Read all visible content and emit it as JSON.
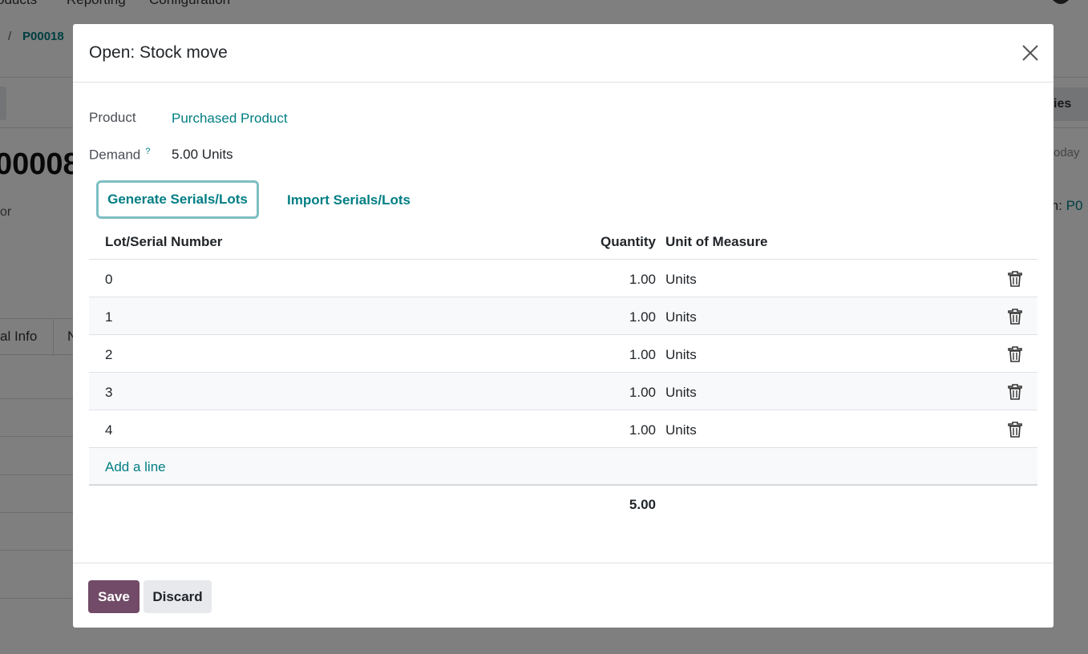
{
  "background": {
    "menu": [
      "oducts",
      "Reporting",
      "Configuration"
    ],
    "breadcrumb_separator": "/",
    "breadcrumb_current": "P00018",
    "record_title": "00008",
    "vendor_label_fragment": "or",
    "tab_other_info": "al Info",
    "tab_next_fragment": "N",
    "right_button_fragment": "ies",
    "right_today_fragment": "oday",
    "right_from_label": "m:",
    "right_from_link": "P0"
  },
  "modal": {
    "title": "Open: Stock move",
    "product_label": "Product",
    "product_value": "Purchased Product",
    "demand_label": "Demand",
    "demand_help": "?",
    "demand_value": "5.00 Units",
    "generate_button": "Generate Serials/Lots",
    "import_button": "Import Serials/Lots",
    "table": {
      "columns": {
        "lot": "Lot/Serial Number",
        "quantity": "Quantity",
        "uom": "Unit of Measure"
      },
      "rows": [
        {
          "lot": "0",
          "quantity": "1.00",
          "uom": "Units"
        },
        {
          "lot": "1",
          "quantity": "1.00",
          "uom": "Units"
        },
        {
          "lot": "2",
          "quantity": "1.00",
          "uom": "Units"
        },
        {
          "lot": "3",
          "quantity": "1.00",
          "uom": "Units"
        },
        {
          "lot": "4",
          "quantity": "1.00",
          "uom": "Units"
        }
      ],
      "add_line": "Add a line",
      "total": "5.00"
    },
    "footer": {
      "save": "Save",
      "discard": "Discard"
    }
  },
  "colors": {
    "accent_teal": "#017e84",
    "primary_purple": "#714b67"
  }
}
